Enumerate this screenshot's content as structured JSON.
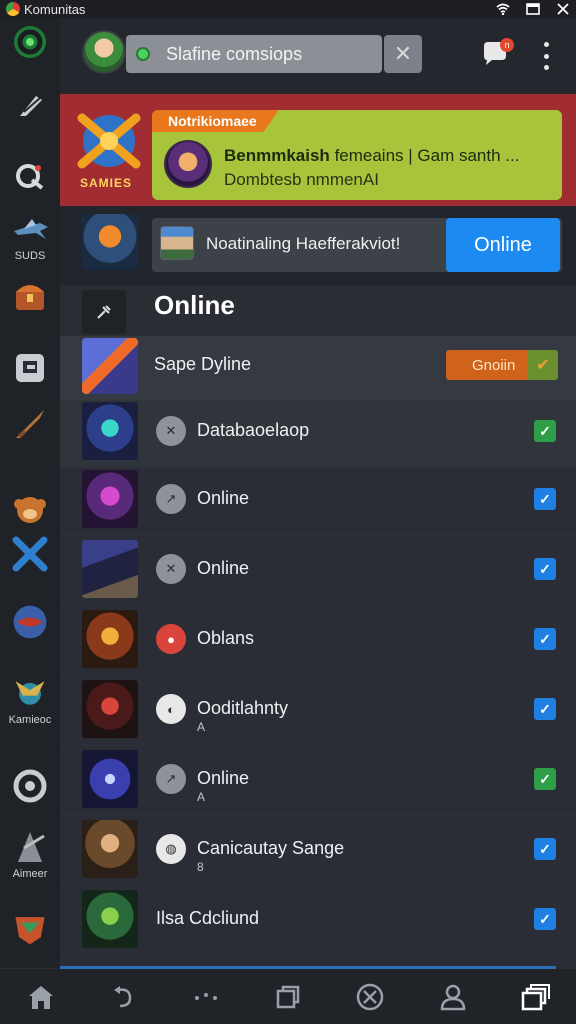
{
  "statusbar": {
    "app_name": "Komunitas"
  },
  "rail": {
    "items": [
      {
        "icon": "green-ring-icon",
        "label": ""
      },
      {
        "icon": "feather-icon",
        "label": ""
      },
      {
        "icon": "q-badge-icon",
        "label": ""
      },
      {
        "icon": "jet-icon",
        "label": "SUDS"
      },
      {
        "icon": "treasure-chest-icon",
        "label": ""
      },
      {
        "icon": "square-tile-icon",
        "label": ""
      },
      {
        "icon": "sword-icon",
        "label": ""
      },
      {
        "icon": "monkey-icon",
        "label": ""
      },
      {
        "icon": "crossed-swords-icon",
        "label": ""
      },
      {
        "icon": "planet-icon",
        "label": ""
      },
      {
        "icon": "warrior-icon",
        "label": "Kamieoc"
      },
      {
        "icon": "target-ring-icon",
        "label": ""
      },
      {
        "icon": "knight-icon",
        "label": "Aimeer"
      },
      {
        "icon": "shield-crest-icon",
        "label": ""
      }
    ]
  },
  "header": {
    "search_placeholder": "Slafine comsiops",
    "notification_count": "n"
  },
  "banner": {
    "game_name": "SAMIES",
    "notice_tag": "Notrikiomaee",
    "notice_title_bold": "Benmmkaish",
    "notice_title_rest": "femeains | Gam santh ...",
    "notice_subtitle": "Dombtesb nmmenAI"
  },
  "invite": {
    "text": "Noatinaling Haefferakviot!",
    "button_label": "Online"
  },
  "section": {
    "title": "Online"
  },
  "highlight_row": {
    "name": "Sape Dyline",
    "button_label": "Gnoiin"
  },
  "rows": [
    {
      "name": "Databaoelaop",
      "sub": "",
      "status": "grey",
      "check": "green"
    },
    {
      "name": "Online",
      "sub": "",
      "status": "grey",
      "check": "blue"
    },
    {
      "name": "Online",
      "sub": "",
      "status": "grey",
      "check": "blue"
    },
    {
      "name": "Oblans",
      "sub": "",
      "status": "red",
      "check": "blue"
    },
    {
      "name": "Ooditlahnty",
      "sub": "A",
      "status": "ring",
      "check": "blue"
    },
    {
      "name": "Online",
      "sub": "A",
      "status": "grey",
      "check": "green"
    },
    {
      "name": "Canicautay Sange",
      "sub": "8",
      "status": "ring",
      "check": "blue"
    },
    {
      "name": "Ilsa Cdcliund",
      "sub": "",
      "status": "none",
      "check": "blue"
    }
  ],
  "bottomnav": {
    "items": [
      "home-icon",
      "back-icon",
      "dots-icon",
      "copy-icon",
      "cross-circle-icon",
      "people-icon",
      "stack-icon"
    ]
  }
}
